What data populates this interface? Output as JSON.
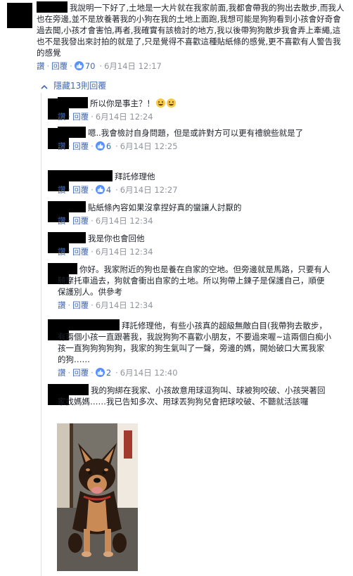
{
  "main_comment": {
    "text": "我說明一下好了,土地是一大片就在我家前面,我都會帶我的狗出去散步,而我人也在旁邊,並不是放養著我的小狗在我的土地上面跑,我想可能是狗狗看到小孩會好奇會過去聞,小孩才會害怕,再者,我確實有該檢討的地方,我以後帶狗狗散步我會弄上牽繩,這也不是我發出來討拍的就是了,只是覺得不喜歡這種貼紙條的感覺,更不喜歡有人警告我的感覺",
    "reply_label": "讚",
    "reply_btn": "回覆",
    "likes": "70",
    "time": "6月14日 12:17"
  },
  "hidden_replies_label": "隱藏13則回覆",
  "icons": {
    "like": "like-icon",
    "collapse": "chevron-up-icon",
    "emoji": "grinning-face-icon"
  },
  "colors": {
    "link": "#4267b2",
    "meta": "#90949c",
    "like_bg": "#5890ff"
  },
  "replies": [
    {
      "text": "所以你是事主？！",
      "like_label": "讚",
      "reply_label": "回覆",
      "likes": "",
      "time": "6月14日 12:24",
      "emoji": true
    },
    {
      "text": "嗯..我會檢討自身問題，但是或許對方可以更有禮貌些就是了",
      "like_label": "讚",
      "reply_label": "回覆",
      "likes": "6",
      "time": "6月14日 12:25"
    },
    {
      "text": "拜託修理他",
      "like_label": "讚",
      "reply_label": "回覆",
      "likes": "4",
      "time": "6月14日 12:27"
    },
    {
      "text": "貼紙條內容如果沒拿捏好真的蠻讓人討厭的",
      "like_label": "讚",
      "reply_label": "回覆",
      "likes": "",
      "time": "6月14日 12:34"
    },
    {
      "text": "我是你也會回他",
      "like_label": "讚",
      "reply_label": "回覆",
      "likes": "",
      "time": "6月14日 12:34"
    },
    {
      "text": "你好。我家附近的狗也是養在自家的空地。但旁邊就是馬路，只要有人騎摩托車過去，狗就會衝出自家的土地。所以狗帶上鍊子是保護自己，順便保護別人。供參考",
      "like_label": "讚",
      "reply_label": "回覆",
      "likes": "",
      "time": "6月14日 12:34"
    },
    {
      "text": "拜託修理他，有些小孩真的超級無敵白目(我帶狗去散步，有兩個小孩一直跟著我，我說狗狗不喜歡小朋友，不要過來喔~這兩個白痴小孩一直狗狗狗狗狗，我家的狗生氣叫了一聲，旁邊的媽，開始破口大罵我家的狗……",
      "like_label": "讚",
      "reply_label": "回覆",
      "likes": "2",
      "time": "6月14日 12:40"
    },
    {
      "text": "我的狗綁在我家、小孩故意用球逗狗叫、球被狗咬破、小孩哭著回家找媽媽……我已告知多次、用球丟狗狗兒會把球咬破、不聽就活該囉"
    }
  ]
}
